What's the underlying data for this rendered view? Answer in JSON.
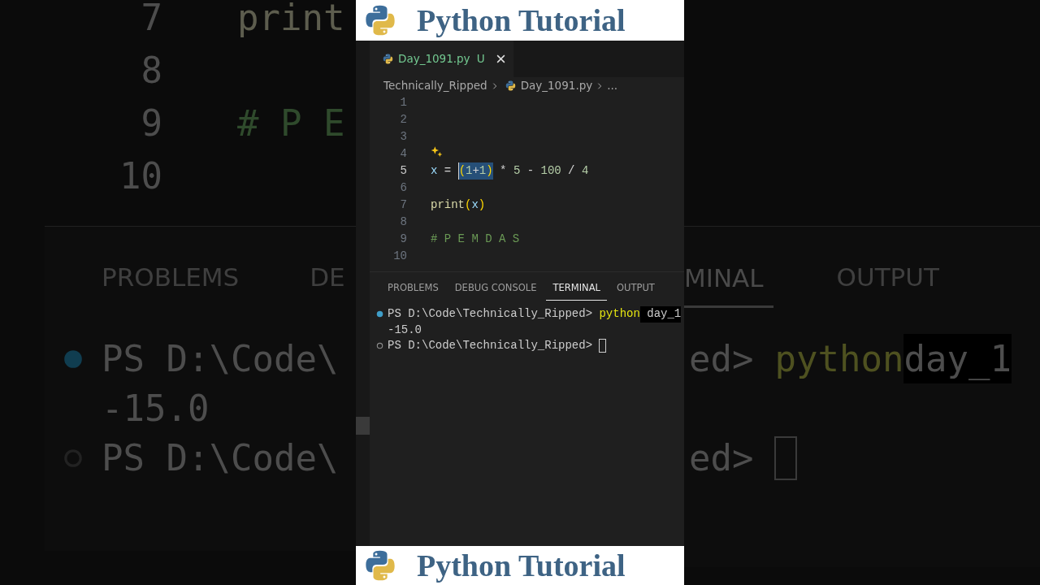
{
  "backdrop": {
    "left": {
      "editor_lines": [
        {
          "number": "7",
          "code": "print",
          "kind": "function"
        },
        {
          "number": "8"
        },
        {
          "number": "9",
          "code": "# P E",
          "kind": "comment"
        },
        {
          "number": "10"
        }
      ],
      "panel_tabs": [
        "PROBLEMS",
        "DE"
      ],
      "terminal": [
        {
          "succeeded": true,
          "text": "PS D:\\Code\\"
        },
        {
          "text": "-15.0"
        },
        {
          "succeeded": false,
          "text": "PS D:\\Code\\"
        }
      ]
    },
    "right": {
      "panel_tabs": [
        {
          "label": "MINAL",
          "selected": true
        },
        {
          "label": "OUTPUT",
          "selected": false
        }
      ],
      "terminal": [
        {
          "prompt": "ed>",
          "command": "python",
          "argument": "day_1"
        },
        {
          "prompt": "ed>",
          "cursor": true
        }
      ]
    }
  },
  "top_banner": {
    "title": "Python Tutorial"
  },
  "editor": {
    "tabs": [
      {
        "label": "Day_1091.py",
        "badge": "U",
        "selected": true
      }
    ],
    "breadcrumbs": [
      "Technically_Ripped",
      "Day_1091.py",
      "..."
    ],
    "lines": [
      {
        "number": "1",
        "current": false
      },
      {
        "number": "2",
        "current": false
      },
      {
        "number": "3",
        "current": false
      },
      {
        "number": "4",
        "current": false,
        "hint": true
      },
      {
        "number": "5",
        "current": true,
        "cursor": true,
        "tokens": [
          {
            "text": "x",
            "kind": "variable",
            "selected": false
          },
          {
            "text": " = ",
            "kind": "operator",
            "selected": false
          },
          {
            "text": "(",
            "kind": "bracket",
            "selected": true
          },
          {
            "text": "1",
            "kind": "number",
            "selected": true
          },
          {
            "text": "+",
            "kind": "operator",
            "selected": true
          },
          {
            "text": "1",
            "kind": "number",
            "selected": true
          },
          {
            "text": ")",
            "kind": "bracket",
            "selected": true
          },
          {
            "text": " * ",
            "kind": "operator",
            "selected": false
          },
          {
            "text": "5",
            "kind": "number",
            "selected": false
          },
          {
            "text": " - ",
            "kind": "operator",
            "selected": false
          },
          {
            "text": "100",
            "kind": "number",
            "selected": false
          },
          {
            "text": " / ",
            "kind": "operator",
            "selected": false
          },
          {
            "text": "4",
            "kind": "number",
            "selected": false
          }
        ]
      },
      {
        "number": "6",
        "current": false
      },
      {
        "number": "7",
        "current": false,
        "tokens": [
          {
            "text": "print",
            "kind": "function",
            "selected": false
          },
          {
            "text": "(",
            "kind": "bracket",
            "selected": false
          },
          {
            "text": "x",
            "kind": "variable",
            "selected": false
          },
          {
            "text": ")",
            "kind": "bracket",
            "selected": false
          }
        ]
      },
      {
        "number": "8",
        "current": false
      },
      {
        "number": "9",
        "current": false,
        "tokens": [
          {
            "text": "# P E M D A S",
            "kind": "comment",
            "selected": false
          }
        ]
      },
      {
        "number": "10",
        "current": false
      }
    ]
  },
  "panel": {
    "tabs": [
      {
        "label": "PROBLEMS",
        "selected": false
      },
      {
        "label": "DEBUG CONSOLE",
        "selected": false
      },
      {
        "label": "TERMINAL",
        "selected": true
      },
      {
        "label": "OUTPUT",
        "selected": false
      }
    ],
    "terminal": [
      {
        "kind": "command",
        "succeeded": true,
        "prompt": "PS D:\\Code\\Technically_Ripped>",
        "command": "python",
        "argument": "day_1"
      },
      {
        "kind": "output",
        "text": "-15.0"
      },
      {
        "kind": "prompt",
        "succeeded": false,
        "prompt": "PS D:\\Code\\Technically_Ripped>",
        "cursor": true
      }
    ]
  },
  "bottom_banner": {
    "title": "Python Tutorial"
  }
}
